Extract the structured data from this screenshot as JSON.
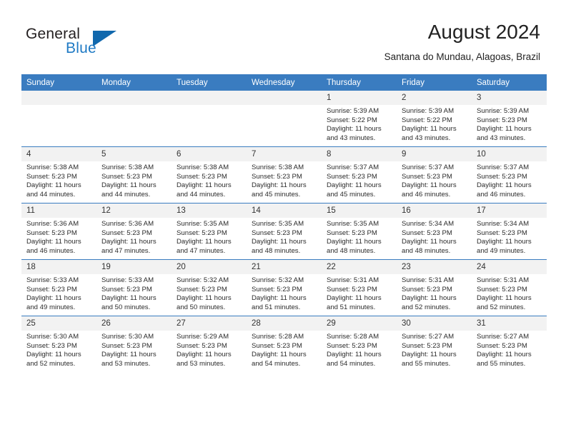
{
  "logo": {
    "word1": "General",
    "word2": "Blue",
    "triangle_color": "#1168ad",
    "blue_text_color": "#1f7ac4",
    "icon": "triangle-icon"
  },
  "header": {
    "title": "August 2024",
    "location": "Santana do Mundau, Alagoas, Brazil"
  },
  "calendar": {
    "header_bg": "#3a7cc0",
    "daynum_bg": "#f2f2f2",
    "weekday_headers": [
      "Sunday",
      "Monday",
      "Tuesday",
      "Wednesday",
      "Thursday",
      "Friday",
      "Saturday"
    ],
    "labels": {
      "sunrise": "Sunrise:",
      "sunset": "Sunset:",
      "daylight": "Daylight:"
    },
    "weeks": [
      [
        {
          "day": "",
          "empty": true
        },
        {
          "day": "",
          "empty": true
        },
        {
          "day": "",
          "empty": true
        },
        {
          "day": "",
          "empty": true
        },
        {
          "day": "1",
          "sunrise": "Sunrise: 5:39 AM",
          "sunset": "Sunset: 5:22 PM",
          "daylight1": "Daylight: 11 hours",
          "daylight2": "and 43 minutes."
        },
        {
          "day": "2",
          "sunrise": "Sunrise: 5:39 AM",
          "sunset": "Sunset: 5:22 PM",
          "daylight1": "Daylight: 11 hours",
          "daylight2": "and 43 minutes."
        },
        {
          "day": "3",
          "sunrise": "Sunrise: 5:39 AM",
          "sunset": "Sunset: 5:23 PM",
          "daylight1": "Daylight: 11 hours",
          "daylight2": "and 43 minutes."
        }
      ],
      [
        {
          "day": "4",
          "sunrise": "Sunrise: 5:38 AM",
          "sunset": "Sunset: 5:23 PM",
          "daylight1": "Daylight: 11 hours",
          "daylight2": "and 44 minutes."
        },
        {
          "day": "5",
          "sunrise": "Sunrise: 5:38 AM",
          "sunset": "Sunset: 5:23 PM",
          "daylight1": "Daylight: 11 hours",
          "daylight2": "and 44 minutes."
        },
        {
          "day": "6",
          "sunrise": "Sunrise: 5:38 AM",
          "sunset": "Sunset: 5:23 PM",
          "daylight1": "Daylight: 11 hours",
          "daylight2": "and 44 minutes."
        },
        {
          "day": "7",
          "sunrise": "Sunrise: 5:38 AM",
          "sunset": "Sunset: 5:23 PM",
          "daylight1": "Daylight: 11 hours",
          "daylight2": "and 45 minutes."
        },
        {
          "day": "8",
          "sunrise": "Sunrise: 5:37 AM",
          "sunset": "Sunset: 5:23 PM",
          "daylight1": "Daylight: 11 hours",
          "daylight2": "and 45 minutes."
        },
        {
          "day": "9",
          "sunrise": "Sunrise: 5:37 AM",
          "sunset": "Sunset: 5:23 PM",
          "daylight1": "Daylight: 11 hours",
          "daylight2": "and 46 minutes."
        },
        {
          "day": "10",
          "sunrise": "Sunrise: 5:37 AM",
          "sunset": "Sunset: 5:23 PM",
          "daylight1": "Daylight: 11 hours",
          "daylight2": "and 46 minutes."
        }
      ],
      [
        {
          "day": "11",
          "sunrise": "Sunrise: 5:36 AM",
          "sunset": "Sunset: 5:23 PM",
          "daylight1": "Daylight: 11 hours",
          "daylight2": "and 46 minutes."
        },
        {
          "day": "12",
          "sunrise": "Sunrise: 5:36 AM",
          "sunset": "Sunset: 5:23 PM",
          "daylight1": "Daylight: 11 hours",
          "daylight2": "and 47 minutes."
        },
        {
          "day": "13",
          "sunrise": "Sunrise: 5:35 AM",
          "sunset": "Sunset: 5:23 PM",
          "daylight1": "Daylight: 11 hours",
          "daylight2": "and 47 minutes."
        },
        {
          "day": "14",
          "sunrise": "Sunrise: 5:35 AM",
          "sunset": "Sunset: 5:23 PM",
          "daylight1": "Daylight: 11 hours",
          "daylight2": "and 48 minutes."
        },
        {
          "day": "15",
          "sunrise": "Sunrise: 5:35 AM",
          "sunset": "Sunset: 5:23 PM",
          "daylight1": "Daylight: 11 hours",
          "daylight2": "and 48 minutes."
        },
        {
          "day": "16",
          "sunrise": "Sunrise: 5:34 AM",
          "sunset": "Sunset: 5:23 PM",
          "daylight1": "Daylight: 11 hours",
          "daylight2": "and 48 minutes."
        },
        {
          "day": "17",
          "sunrise": "Sunrise: 5:34 AM",
          "sunset": "Sunset: 5:23 PM",
          "daylight1": "Daylight: 11 hours",
          "daylight2": "and 49 minutes."
        }
      ],
      [
        {
          "day": "18",
          "sunrise": "Sunrise: 5:33 AM",
          "sunset": "Sunset: 5:23 PM",
          "daylight1": "Daylight: 11 hours",
          "daylight2": "and 49 minutes."
        },
        {
          "day": "19",
          "sunrise": "Sunrise: 5:33 AM",
          "sunset": "Sunset: 5:23 PM",
          "daylight1": "Daylight: 11 hours",
          "daylight2": "and 50 minutes."
        },
        {
          "day": "20",
          "sunrise": "Sunrise: 5:32 AM",
          "sunset": "Sunset: 5:23 PM",
          "daylight1": "Daylight: 11 hours",
          "daylight2": "and 50 minutes."
        },
        {
          "day": "21",
          "sunrise": "Sunrise: 5:32 AM",
          "sunset": "Sunset: 5:23 PM",
          "daylight1": "Daylight: 11 hours",
          "daylight2": "and 51 minutes."
        },
        {
          "day": "22",
          "sunrise": "Sunrise: 5:31 AM",
          "sunset": "Sunset: 5:23 PM",
          "daylight1": "Daylight: 11 hours",
          "daylight2": "and 51 minutes."
        },
        {
          "day": "23",
          "sunrise": "Sunrise: 5:31 AM",
          "sunset": "Sunset: 5:23 PM",
          "daylight1": "Daylight: 11 hours",
          "daylight2": "and 52 minutes."
        },
        {
          "day": "24",
          "sunrise": "Sunrise: 5:31 AM",
          "sunset": "Sunset: 5:23 PM",
          "daylight1": "Daylight: 11 hours",
          "daylight2": "and 52 minutes."
        }
      ],
      [
        {
          "day": "25",
          "sunrise": "Sunrise: 5:30 AM",
          "sunset": "Sunset: 5:23 PM",
          "daylight1": "Daylight: 11 hours",
          "daylight2": "and 52 minutes."
        },
        {
          "day": "26",
          "sunrise": "Sunrise: 5:30 AM",
          "sunset": "Sunset: 5:23 PM",
          "daylight1": "Daylight: 11 hours",
          "daylight2": "and 53 minutes."
        },
        {
          "day": "27",
          "sunrise": "Sunrise: 5:29 AM",
          "sunset": "Sunset: 5:23 PM",
          "daylight1": "Daylight: 11 hours",
          "daylight2": "and 53 minutes."
        },
        {
          "day": "28",
          "sunrise": "Sunrise: 5:28 AM",
          "sunset": "Sunset: 5:23 PM",
          "daylight1": "Daylight: 11 hours",
          "daylight2": "and 54 minutes."
        },
        {
          "day": "29",
          "sunrise": "Sunrise: 5:28 AM",
          "sunset": "Sunset: 5:23 PM",
          "daylight1": "Daylight: 11 hours",
          "daylight2": "and 54 minutes."
        },
        {
          "day": "30",
          "sunrise": "Sunrise: 5:27 AM",
          "sunset": "Sunset: 5:23 PM",
          "daylight1": "Daylight: 11 hours",
          "daylight2": "and 55 minutes."
        },
        {
          "day": "31",
          "sunrise": "Sunrise: 5:27 AM",
          "sunset": "Sunset: 5:23 PM",
          "daylight1": "Daylight: 11 hours",
          "daylight2": "and 55 minutes."
        }
      ]
    ]
  }
}
